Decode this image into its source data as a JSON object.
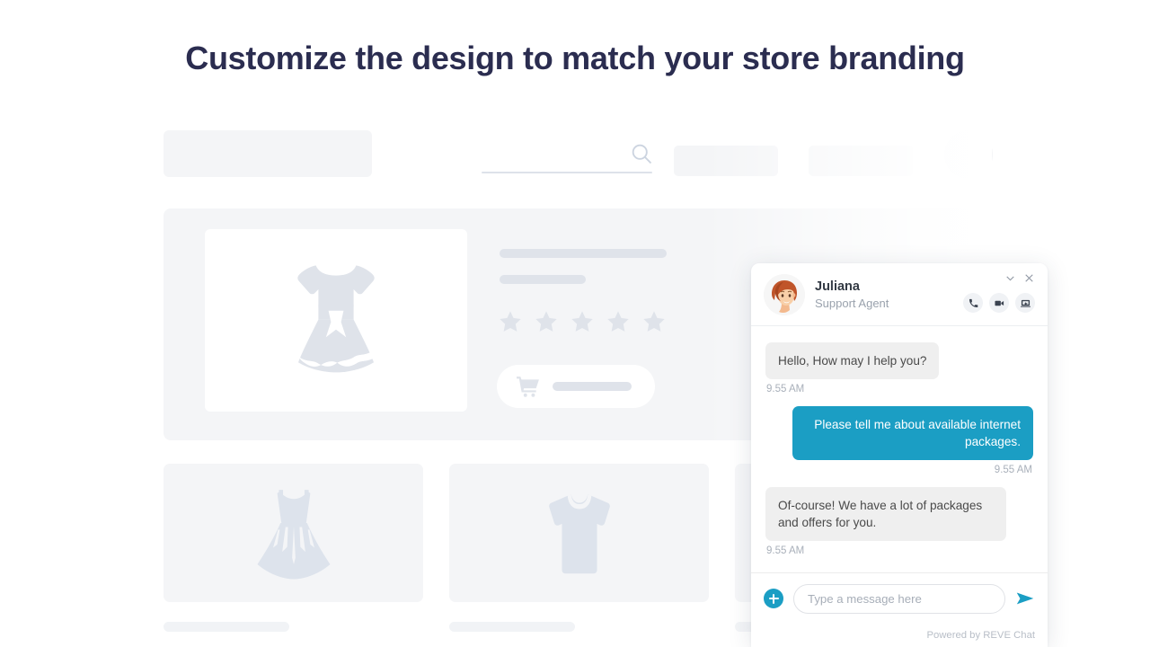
{
  "headline": "Customize the design to match your store branding",
  "storefront_mockup": {
    "logo_placeholder": "",
    "search_placeholder": "",
    "nav_items": [
      "",
      ""
    ],
    "account_avatar": "",
    "hero": {
      "product_image_icon": "dress-icon",
      "title_bar": "",
      "subtitle_bar": "",
      "rating_stars": 5,
      "add_to_cart_label": ""
    },
    "product_cards": [
      {
        "icon": "gown-icon",
        "label": ""
      },
      {
        "icon": "tshirt-icon",
        "label": ""
      },
      {
        "icon": "blank-icon",
        "label": ""
      }
    ]
  },
  "chat_widget": {
    "agent_name": "Juliana",
    "agent_role": "Support Agent",
    "avatar_icon": "agent-avatar-icon",
    "window_controls": [
      {
        "name": "minimize",
        "icon": "chevron-down-icon"
      },
      {
        "name": "close",
        "icon": "close-icon"
      }
    ],
    "header_actions": [
      {
        "name": "voice-call",
        "icon": "phone-icon"
      },
      {
        "name": "video-call",
        "icon": "video-camera-icon"
      },
      {
        "name": "screen-share",
        "icon": "screen-share-icon"
      }
    ],
    "messages": [
      {
        "sender": "agent",
        "text": "Hello, How may I help you?",
        "time": "9.55 AM"
      },
      {
        "sender": "user",
        "text": "Please tell me about available internet packages.",
        "time": "9.55 AM"
      },
      {
        "sender": "agent",
        "text": "Of-course! We have a lot of packages and offers for you.",
        "time": "9.55 AM"
      }
    ],
    "composer": {
      "attach_icon": "plus-icon",
      "input_value": "",
      "input_placeholder": "Type a message here",
      "send_icon": "send-icon"
    },
    "footer_text": "Powered by REVE Chat",
    "accent_color": "#1b9ec4",
    "agent_bubble_color": "#efefef",
    "headline_color": "#2b2d50"
  }
}
